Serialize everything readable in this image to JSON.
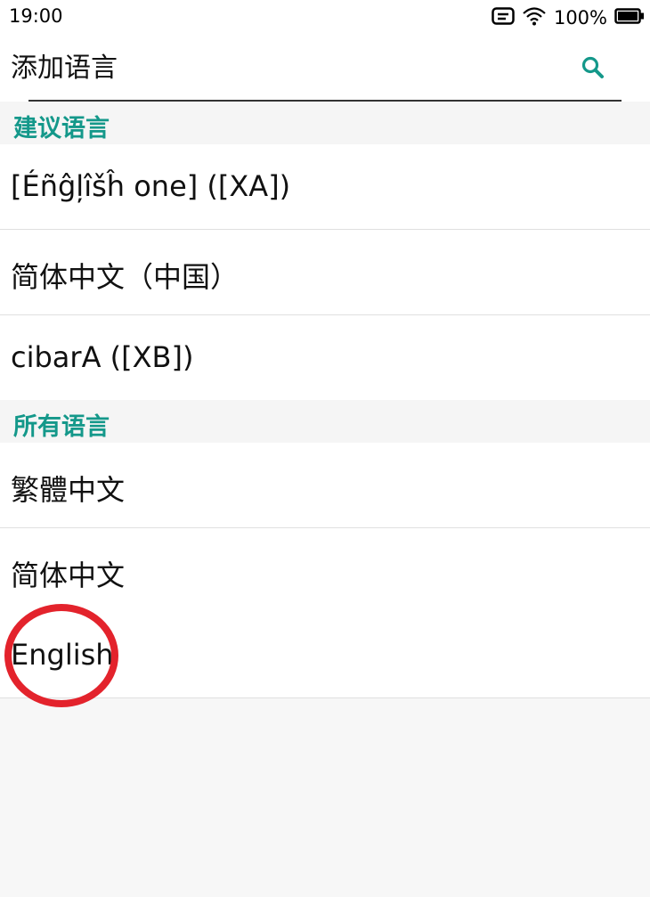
{
  "status_bar": {
    "time": "19:00",
    "battery": "100%",
    "icons": [
      "notification-icon",
      "wifi-icon",
      "battery-icon"
    ]
  },
  "header": {
    "search_placeholder": "添加语言",
    "search_icon": "search-icon"
  },
  "sections": {
    "suggested": {
      "title": "建议语言",
      "items": [
        "[Éñĝļîšĥ one] ([XA])",
        "简体中文（中国）",
        "cibarA ([XB])"
      ]
    },
    "all": {
      "title": "所有语言",
      "items": [
        "繁體中文",
        "简体中文",
        "English"
      ]
    }
  },
  "colors": {
    "accent": "#14988a",
    "annotation": "#e3232c",
    "background": "#f7f7f7"
  }
}
